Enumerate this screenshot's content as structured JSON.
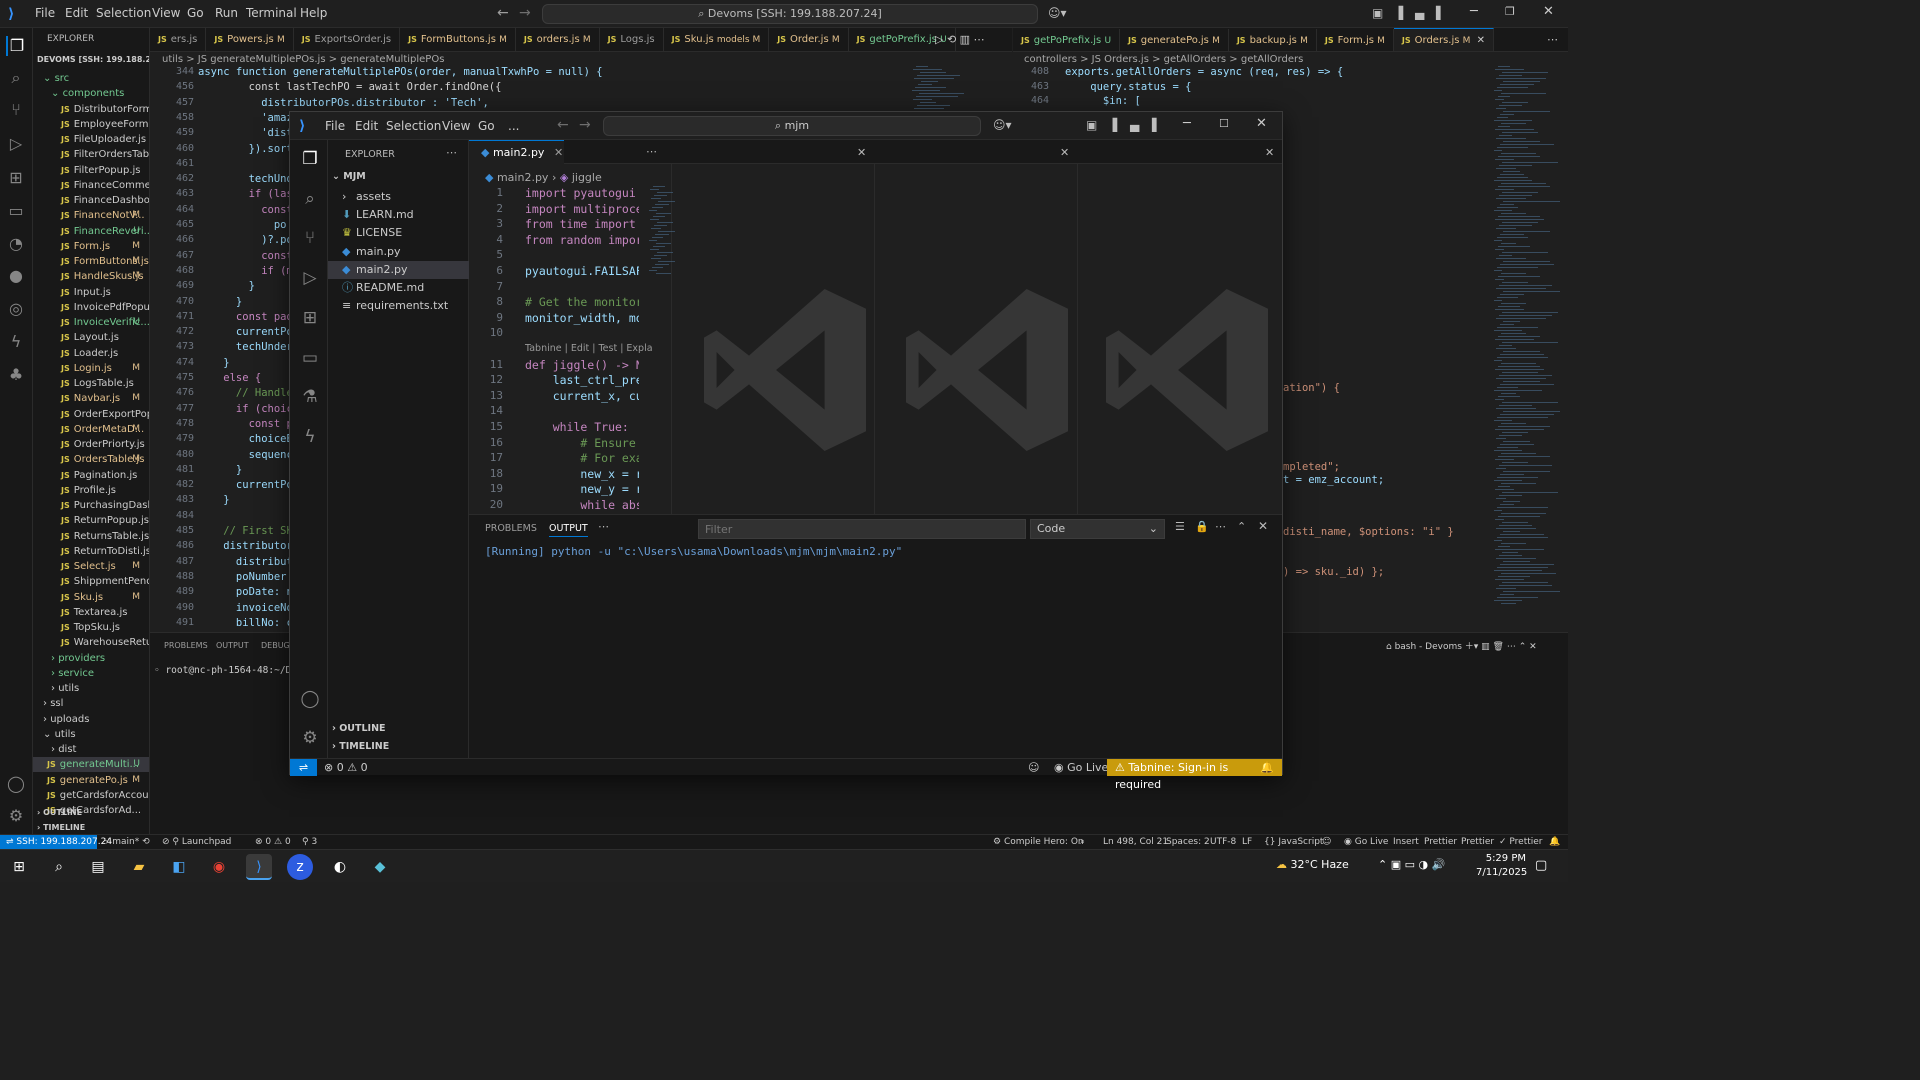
{
  "title_bar": {
    "menus": [
      "File",
      "Edit",
      "Selection",
      "View",
      "Go",
      "Run",
      "Terminal",
      "Help"
    ],
    "command_center": "Devoms [SSH: 199.188.207.24]"
  },
  "explorer": {
    "header": "EXPLORER",
    "root": "DEVOMS [SSH: 199.188.20...",
    "items": [
      {
        "label": "src",
        "status": ""
      },
      {
        "label": "components",
        "status": ""
      },
      {
        "label": "DistributorForm.js",
        "status": ""
      },
      {
        "label": "EmployeeForm.js",
        "status": ""
      },
      {
        "label": "FileUploader.js",
        "status": ""
      },
      {
        "label": "FilterOrdersTable.js",
        "status": ""
      },
      {
        "label": "FilterPopup.js",
        "status": ""
      },
      {
        "label": "FinanceComments.js",
        "status": ""
      },
      {
        "label": "FinanceDashboard.js",
        "status": ""
      },
      {
        "label": "FinanceNotV...",
        "status": "M"
      },
      {
        "label": "FinanceReveri...",
        "status": "U"
      },
      {
        "label": "Form.js",
        "status": "M"
      },
      {
        "label": "FormButtons.js",
        "status": "M"
      },
      {
        "label": "HandleSkus.js",
        "status": "M"
      },
      {
        "label": "Input.js",
        "status": ""
      },
      {
        "label": "InvoicePdfPopup.js",
        "status": ""
      },
      {
        "label": "InvoiceVerific...",
        "status": "U"
      },
      {
        "label": "Layout.js",
        "status": ""
      },
      {
        "label": "Loader.js",
        "status": ""
      },
      {
        "label": "Login.js",
        "status": "M"
      },
      {
        "label": "LogsTable.js",
        "status": ""
      },
      {
        "label": "Navbar.js",
        "status": "M"
      },
      {
        "label": "OrderExportPopup.js",
        "status": ""
      },
      {
        "label": "OrderMetaD...",
        "status": "M"
      },
      {
        "label": "OrderPriorty.js",
        "status": ""
      },
      {
        "label": "OrdersTable.js",
        "status": "M"
      },
      {
        "label": "Pagination.js",
        "status": ""
      },
      {
        "label": "Profile.js",
        "status": ""
      },
      {
        "label": "PurchasingDashbo...",
        "status": ""
      },
      {
        "label": "ReturnPopup.js",
        "status": ""
      },
      {
        "label": "ReturnsTable.js",
        "status": ""
      },
      {
        "label": "ReturnToDisti.js",
        "status": ""
      },
      {
        "label": "Select.js",
        "status": "M"
      },
      {
        "label": "ShippmentPending...",
        "status": ""
      },
      {
        "label": "Sku.js",
        "status": "M"
      },
      {
        "label": "Textarea.js",
        "status": ""
      },
      {
        "label": "TopSku.js",
        "status": ""
      },
      {
        "label": "WarehouseReturn.js",
        "status": ""
      },
      {
        "label": "providers",
        "status": ""
      },
      {
        "label": "service",
        "status": ""
      },
      {
        "label": "utils",
        "status": ""
      },
      {
        "label": "ssl",
        "status": ""
      },
      {
        "label": "uploads",
        "status": ""
      },
      {
        "label": "utils",
        "status": ""
      },
      {
        "label": "dist",
        "status": ""
      },
      {
        "label": "generateMulti...",
        "status": "U"
      },
      {
        "label": "generatePo.js",
        "status": "M"
      },
      {
        "label": "getCardsforAccount.js",
        "status": ""
      },
      {
        "label": "getCardsforAd...",
        "status": ""
      }
    ],
    "outline": "OUTLINE",
    "timeline": "TIMELINE"
  },
  "left_tabs": [
    {
      "label": "ers.js",
      "status": ""
    },
    {
      "label": "Powers.js",
      "status": "M"
    },
    {
      "label": "ExportsOrder.js",
      "status": ""
    },
    {
      "label": "FormButtons.js",
      "status": "M"
    },
    {
      "label": "orders.js",
      "status": "M"
    },
    {
      "label": "Logs.js",
      "status": ""
    },
    {
      "label": "Sku.js",
      "status": "models M"
    },
    {
      "label": "Order.js",
      "status": "M"
    },
    {
      "label": "getPoPrefix.js",
      "status": "U"
    }
  ],
  "right_tabs": [
    {
      "label": "getPoPrefix.js",
      "status": "U"
    },
    {
      "label": "generatePo.js",
      "status": "M"
    },
    {
      "label": "backup.js",
      "status": "M"
    },
    {
      "label": "Form.js",
      "status": "M"
    },
    {
      "label": "Orders.js",
      "status": "M"
    }
  ],
  "left_editor": {
    "breadcrumb": "utils > JS generateMultiplePOs.js > generateMultiplePOs",
    "sticky": [
      {
        "n": "344",
        "t": "async function generateMultiplePOs(order, manualTxwhPo = null) {"
      },
      {
        "n": "456",
        "t": "        const lastTechPO = await Order.findOne({"
      }
    ],
    "lines": [
      {
        "n": "457",
        "t": "          distributorPOs.distributor : 'Tech',"
      },
      {
        "n": "458",
        "t": "          'amazonAccount': { $regex: 'Choice', $options: 'i' },"
      },
      {
        "n": "459",
        "t": "          'distri"
      },
      {
        "n": "460",
        "t": "        }).sort({"
      },
      {
        "n": "461",
        "t": ""
      },
      {
        "n": "462",
        "t": "        techUnderC"
      },
      {
        "n": "463",
        "t": "        if (lastTe"
      },
      {
        "n": "464",
        "t": "          const la"
      },
      {
        "n": "465",
        "t": "            po =>"
      },
      {
        "n": "466",
        "t": "          )?.poNum"
      },
      {
        "n": "467",
        "t": "          const ma"
      },
      {
        "n": "468",
        "t": "          if (matc"
      },
      {
        "n": "469",
        "t": "        }"
      },
      {
        "n": "470",
        "t": "      }"
      },
      {
        "n": "471",
        "t": "      const padde"
      },
      {
        "n": "472",
        "t": "      currentPoNum"
      },
      {
        "n": "473",
        "t": "      techUnderCho"
      },
      {
        "n": "474",
        "t": "    }"
      },
      {
        "n": "475",
        "t": "    else {"
      },
      {
        "n": "476",
        "t": "      // Handle C"
      },
      {
        "n": "477",
        "t": "      if (choiceBa"
      },
      {
        "n": "478",
        "t": "        const padd"
      },
      {
        "n": "479",
        "t": "        choiceBase"
      },
      {
        "n": "480",
        "t": "        sequenceNu"
      },
      {
        "n": "481",
        "t": "      }"
      },
      {
        "n": "482",
        "t": "      currentPoNum"
      },
      {
        "n": "483",
        "t": "    }"
      },
      {
        "n": "484",
        "t": ""
      },
      {
        "n": "485",
        "t": "    // First SKU g"
      },
      {
        "n": "486",
        "t": "    distributorPOs"
      },
      {
        "n": "487",
        "t": "      distributor"
      },
      {
        "n": "488",
        "t": "      poNumber: cu"
      },
      {
        "n": "489",
        "t": "      poDate: new"
      },
      {
        "n": "490",
        "t": "      invoiceNo: ("
      },
      {
        "n": "491",
        "t": "      billNo: curr"
      },
      {
        "n": "492",
        "t": "    });"
      },
      {
        "n": "493",
        "t": ""
      },
      {
        "n": "494",
        "t": "    // Additional"
      },
      {
        "n": "495",
        "t": "    for (let i = 1"
      },
      {
        "n": "496",
        "t": "      const suffix"
      },
      {
        "n": "497",
        "t": "      distributorP"
      },
      {
        "n": "498",
        "t": "        distribut"
      }
    ]
  },
  "right_editor": {
    "breadcrumb": "controllers > JS Orders.js > getAllOrders > getAllOrders",
    "lines": [
      {
        "n": "408",
        "t": "exports.getAllOrders = async (req, res) => {"
      },
      {
        "n": "463",
        "t": "    query.status = {"
      },
      {
        "n": "464",
        "t": "      $in: ["
      }
    ],
    "fragments": [
      "ation\") {",
      "mpleted\";",
      "t = emz_account;",
      "disti_name, $options: \"i\" }",
      ") => sku._id) };"
    ]
  },
  "bottom_panel": {
    "tabs": [
      "PROBLEMS",
      "OUTPUT",
      "DEBUG C"
    ],
    "terminal_line": "root@nc-ph-1564-48:~/Devom",
    "terminal_name": "bash - Devoms"
  },
  "status_bar": {
    "remote": "SSH: 199.188.207.24",
    "branch": "main*",
    "launchpad": "Launchpad",
    "errors": "0",
    "warnings": "0",
    "ports": "3",
    "compile_hero": "Compile Hero: On",
    "position": "Ln 498, Col 21",
    "spaces": "Spaces: 2",
    "encoding": "UTF-8",
    "eol": "LF",
    "language": "JavaScript",
    "go_live": "Go Live",
    "insert": "Insert",
    "prettier1": "Prettier",
    "prettier2": "Prettier",
    "prettier3": "Prettier"
  },
  "taskbar": {
    "weather": "32°C  Haze",
    "time": "5:29 PM",
    "date": "7/11/2025"
  },
  "inner_window": {
    "menus": [
      "File",
      "Edit",
      "Selection",
      "View",
      "Go",
      "..."
    ],
    "search": "mjm",
    "explorer_header": "EXPLORER",
    "root": "MJM",
    "files": [
      {
        "label": "assets",
        "icon": "chevron-right"
      },
      {
        "label": "LEARN.md",
        "icon": "markdown"
      },
      {
        "label": "LICENSE",
        "icon": "license"
      },
      {
        "label": "main.py",
        "icon": "python"
      },
      {
        "label": "main2.py",
        "icon": "python"
      },
      {
        "label": "README.md",
        "icon": "info"
      },
      {
        "label": "requirements.txt",
        "icon": "lines"
      }
    ],
    "outline": "OUTLINE",
    "timeline": "TIMELINE",
    "tab": "main2.py",
    "breadcrumb_file": "main2.py",
    "breadcrumb_symbol": "jiggle",
    "lines": [
      {
        "n": "1",
        "t": "import pyautogui"
      },
      {
        "n": "2",
        "t": "import multiproces"
      },
      {
        "n": "3",
        "t": "from time import s"
      },
      {
        "n": "4",
        "t": "from random import"
      },
      {
        "n": "5",
        "t": ""
      },
      {
        "n": "6",
        "t": "pyautogui.FAILSAFE"
      },
      {
        "n": "7",
        "t": ""
      },
      {
        "n": "8",
        "t": "# Get the monitor"
      },
      {
        "n": "9",
        "t": "monitor_width, mon"
      },
      {
        "n": "10",
        "t": ""
      },
      {
        "n": "11",
        "t": "def jiggle() -> No"
      },
      {
        "n": "12",
        "t": "    last_ctrl_pres"
      },
      {
        "n": "13",
        "t": "    current_x, cur"
      },
      {
        "n": "14",
        "t": ""
      },
      {
        "n": "15",
        "t": "    while True:"
      },
      {
        "n": "16",
        "t": "        # Ensure a"
      },
      {
        "n": "17",
        "t": "        # For exam"
      },
      {
        "n": "18",
        "t": "        new_x = ra"
      },
      {
        "n": "19",
        "t": "        new_y = ra"
      },
      {
        "n": "20",
        "t": "        while abs("
      }
    ],
    "codelens": "Tabnine | Edit | Test | Expla",
    "panel_tabs": [
      "PROBLEMS",
      "OUTPUT"
    ],
    "filter_placeholder": "Filter",
    "output_channel": "Code",
    "output_line": "[Running] python -u \"c:\\Users\\usama\\Downloads\\mjm\\mjm\\main2.py\"",
    "status_errors": "0",
    "status_warnings": "0",
    "go_live": "Go Live",
    "tabnine": "Tabnine: Sign-in is required"
  },
  "colors": {
    "accent": "#0078d4",
    "modified": "#e2c08d",
    "untracked": "#73c991",
    "tabnine": "#c99b0c"
  }
}
